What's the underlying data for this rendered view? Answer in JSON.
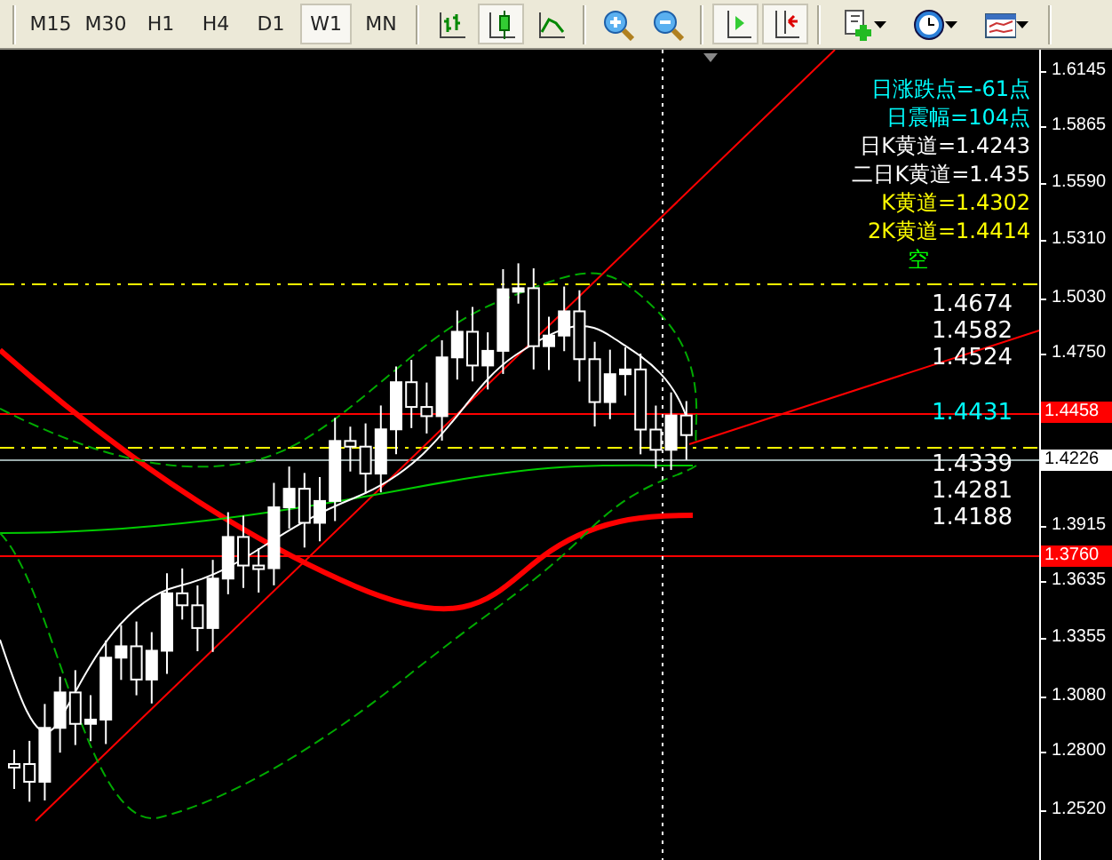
{
  "toolbar": {
    "timeframes": [
      {
        "label": "M15",
        "selected": false
      },
      {
        "label": "M30",
        "selected": false
      },
      {
        "label": "H1",
        "selected": false
      },
      {
        "label": "H4",
        "selected": false
      },
      {
        "label": "D1",
        "selected": false
      },
      {
        "label": "W1",
        "selected": true
      },
      {
        "label": "MN",
        "selected": false
      }
    ],
    "tools": [
      {
        "kind": "bars",
        "selected": false
      },
      {
        "kind": "candles",
        "selected": true
      },
      {
        "kind": "line",
        "selected": false
      },
      {
        "kind": "zoom-in",
        "selected": false
      },
      {
        "kind": "zoom-out",
        "selected": false
      },
      {
        "kind": "shift",
        "selected": true
      },
      {
        "kind": "autoscroll",
        "selected": true
      },
      {
        "kind": "indicators",
        "selected": false
      },
      {
        "kind": "periods",
        "selected": false
      },
      {
        "kind": "templates",
        "selected": false
      }
    ]
  },
  "chart": {
    "info": [
      {
        "text": "日涨跌点=-61点",
        "color": "#00ffff"
      },
      {
        "text": "日震幅=104点",
        "color": "#00ffff"
      },
      {
        "text": "日K黄道=1.4243",
        "color": "#ffffff"
      },
      {
        "text": "二日K黄道=1.435",
        "color": "#ffffff"
      },
      {
        "text": "K黄道=1.4302",
        "color": "#ffff00"
      },
      {
        "text": "2K黄道=1.4414",
        "color": "#ffff00"
      },
      {
        "text": "空",
        "color": "#00ff00"
      }
    ],
    "levels": [
      {
        "text": "1.4674",
        "color": "#ffffff"
      },
      {
        "text": "1.4582",
        "color": "#ffffff"
      },
      {
        "text": "1.4524",
        "color": "#ffffff"
      },
      {
        "text": "1.4431",
        "color": "#00ffff"
      },
      {
        "text": "1.4339",
        "color": "#ffffff"
      },
      {
        "text": "1.4281",
        "color": "#ffffff"
      },
      {
        "text": "1.4188",
        "color": "#ffffff"
      }
    ],
    "price_axis": [
      {
        "text": "1.6145",
        "kind": "tick"
      },
      {
        "text": "1.5865",
        "kind": "tick"
      },
      {
        "text": "1.5590",
        "kind": "tick"
      },
      {
        "text": "1.5310",
        "kind": "tick"
      },
      {
        "text": "1.5030",
        "kind": "tick"
      },
      {
        "text": "1.4750",
        "kind": "tick"
      },
      {
        "text": "1.4458",
        "kind": "line-tag"
      },
      {
        "text": "1.4226",
        "kind": "bid-tag"
      },
      {
        "text": "1.3915",
        "kind": "tick"
      },
      {
        "text": "1.3760",
        "kind": "line-tag"
      },
      {
        "text": "1.3635",
        "kind": "tick"
      },
      {
        "text": "1.3355",
        "kind": "tick"
      },
      {
        "text": "1.3080",
        "kind": "tick"
      },
      {
        "text": "1.2800",
        "kind": "tick"
      },
      {
        "text": "1.2520",
        "kind": "tick"
      }
    ]
  }
}
